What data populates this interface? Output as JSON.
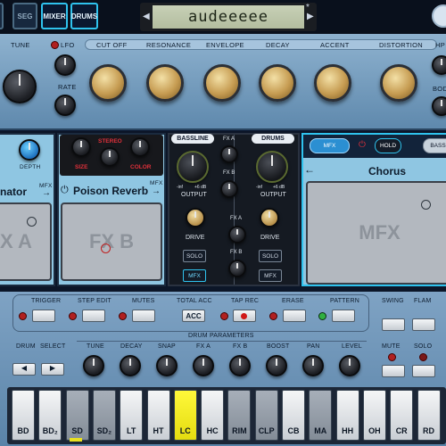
{
  "topbar": {
    "buttons": [
      "SEG",
      "MIXER",
      "DRUMS"
    ],
    "lcd_text": "audeeeee",
    "lcd_flag": "*",
    "prev_arrow": "◀",
    "next_arrow": "▶"
  },
  "synth": {
    "tune_label": "TUNE",
    "lfo_label": "LFO",
    "rate_label": "RATE",
    "knob_labels": [
      "CUT OFF",
      "RESONANCE",
      "ENVELOPE",
      "DECAY",
      "ACCENT",
      "DISTORTION"
    ],
    "hp_label": "HP",
    "body_label": "BOD"
  },
  "fx": {
    "left_depth_label": "DEPTH",
    "left_title": "nator",
    "left_mfx": "MFX",
    "left_screen": "X A",
    "reverb_title": "Poison Reverb",
    "reverb_mfx": "MFX",
    "reverb_stereo": "STEREO",
    "reverb_size": "SIZE",
    "reverb_color": "COLOR",
    "reverb_screen": "FX B",
    "bassline": {
      "tab": "BASSLINE",
      "fxa": "FX A",
      "fxb": "FX B",
      "output": "OUTPUT",
      "drive": "DRIVE",
      "solo": "SOLO",
      "mfx": "MFX",
      "range_min": "-inf",
      "range_max": "+6 dB"
    },
    "drums": {
      "tab": "DRUMS",
      "output": "OUTPUT",
      "fxa": "FX A",
      "fxb": "FX B",
      "drive": "DRIVE",
      "solo": "SOLO",
      "mfx": "MFX",
      "range_min": "-inf",
      "range_max": "+6 dB"
    },
    "mfx_panel": {
      "tab_mfx": "MFX",
      "hold": "HOLD",
      "tab_bass": "BASS",
      "title": "Chorus",
      "back": "←",
      "screen": "MFX"
    }
  },
  "sequencer": {
    "top_labels": [
      "TRIGGER",
      "STEP EDIT",
      "MUTES",
      "TOTAL ACC",
      "TAP REC",
      "ERASE",
      "PATTERN",
      "SWING",
      "FLAM"
    ],
    "acc_button": "ACC",
    "drum_params_title": "DRUM PARAMETERS",
    "drum_label": "DRUM",
    "select_label": "SELECT",
    "param_labels": [
      "TUNE",
      "DECAY",
      "SNAP",
      "FX A",
      "FX B",
      "BOOST",
      "PAN",
      "LEVEL"
    ],
    "mute_label": "MUTE",
    "solo_label": "SOLO",
    "pads": [
      "BD",
      "BD₂",
      "SD",
      "SD₂",
      "LT",
      "HT",
      "LC",
      "HC",
      "RIM",
      "CLP",
      "CB",
      "MA",
      "HH",
      "OH",
      "CR",
      "RD"
    ]
  }
}
